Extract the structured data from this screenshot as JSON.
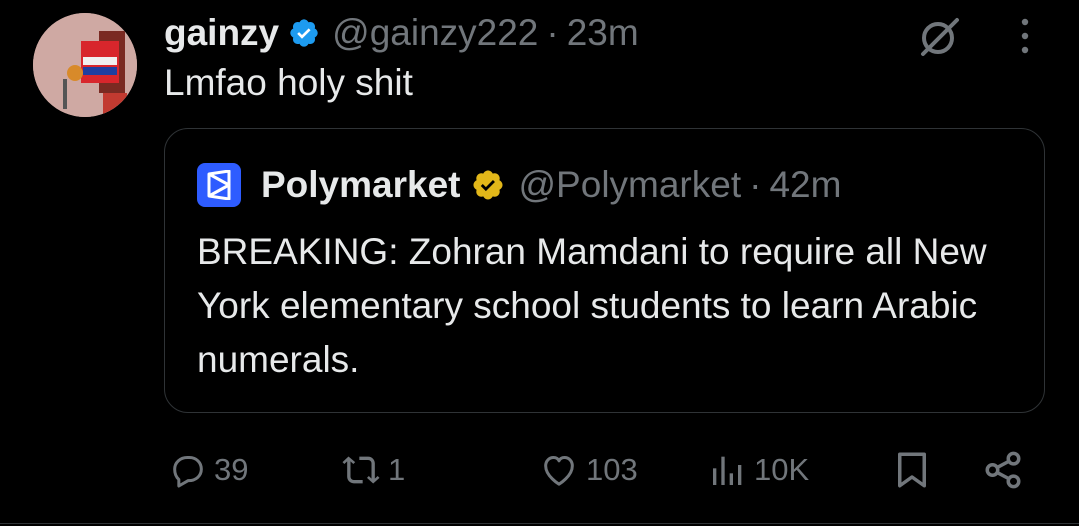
{
  "tweet": {
    "author_name": "gainzy",
    "handle": "@gainzy222",
    "separator": "·",
    "time": "23m",
    "text": "Lmfao holy shit"
  },
  "quote": {
    "author_name": "Polymarket",
    "handle": "@Polymarket",
    "separator": "·",
    "time": "42m",
    "text": "BREAKING: Zohran Mamdani to require all New York elementary school students to learn Arabic numerals."
  },
  "actions": {
    "replies": "39",
    "reposts": "1",
    "likes": "103",
    "views": "10K"
  },
  "icons": {
    "verified": "blue-check-badge",
    "gold_verified": "gold-check-badge",
    "grok": "grok-icon",
    "more": "more-vertical-icon",
    "reply": "reply-icon",
    "repost": "repost-icon",
    "like": "heart-icon",
    "views": "views-icon",
    "bookmark": "bookmark-icon",
    "share": "share-icon"
  },
  "colors": {
    "background": "#000000",
    "text_primary": "#e7e9ea",
    "text_secondary": "#71767b",
    "verified_blue": "#1d9bf0",
    "verified_gold": "#e2b719",
    "polymarket_blue": "#2e5cff",
    "border": "#2f3336"
  }
}
